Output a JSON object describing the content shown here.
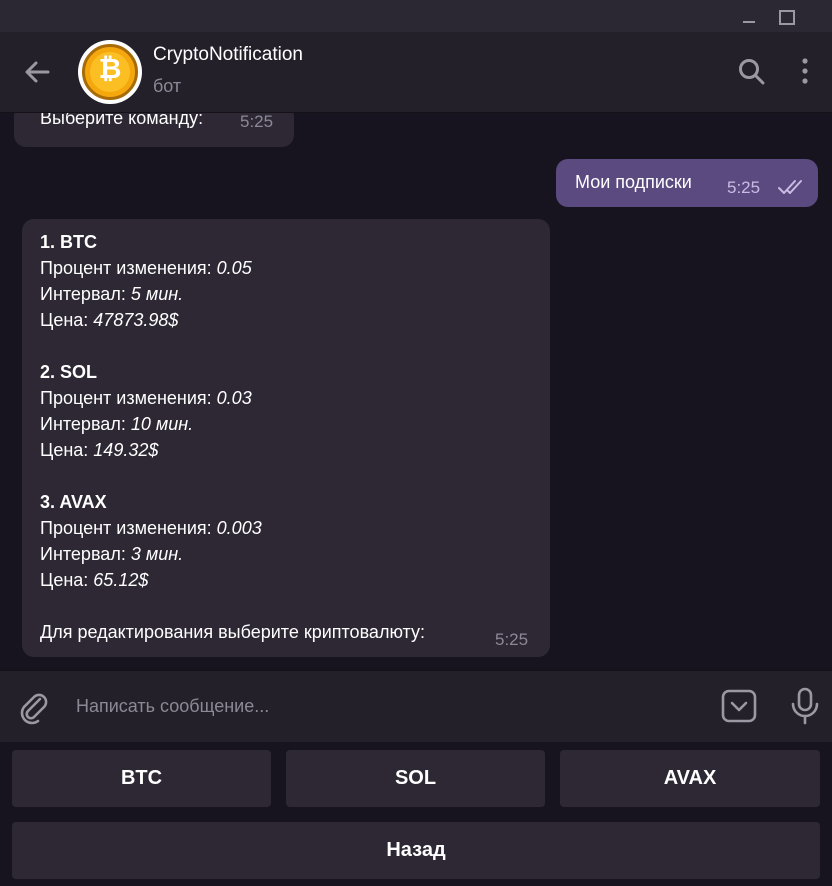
{
  "chat": {
    "title": "CryptoNotification",
    "status": "бот"
  },
  "icons": {
    "back": "arrow-left-icon",
    "avatar": "bitcoin-icon",
    "search": "search-icon",
    "more": "more-vertical-icon",
    "attach": "paperclip-icon",
    "keyboard": "bot-keyboard-icon",
    "mic": "microphone-icon",
    "read": "double-check-icon"
  },
  "messages": [
    {
      "text": "Выберите команду:",
      "time": "5:25",
      "outgoing": false
    },
    {
      "text": "Мои подписки",
      "time": "5:25",
      "outgoing": true,
      "read": true
    },
    {
      "outgoing": false,
      "time": "5:25",
      "subscriptions": [
        {
          "title": "1. BTC",
          "change_label": "Процент изменения:",
          "change": "0.05",
          "interval_label": "Интервал:",
          "interval": "5 мин.",
          "price_label": "Цена:",
          "price": "47873.98$"
        },
        {
          "title": "2. SOL",
          "change_label": "Процент изменения:",
          "change": "0.03",
          "interval_label": "Интервал:",
          "interval": "10 мин.",
          "price_label": "Цена:",
          "price": "149.32$"
        },
        {
          "title": "3. AVAX",
          "change_label": "Процент изменения:",
          "change": "0.003",
          "interval_label": "Интервал:",
          "interval": "3 мин.",
          "price_label": "Цена:",
          "price": "65.12$"
        }
      ],
      "footer": "Для редактирования выберите криптовалюту:"
    }
  ],
  "composer": {
    "placeholder": "Написать сообщение..."
  },
  "keyboard": {
    "buttons": [
      "BTC",
      "SOL",
      "AVAX",
      "Назад"
    ]
  },
  "colors": {
    "background": "#17141f",
    "header": "#23202a",
    "incoming_bubble": "#2d2834",
    "outgoing_bubble": "#5b4a80",
    "secondary_text": "#8d8896",
    "coin": "#f4a80e"
  }
}
